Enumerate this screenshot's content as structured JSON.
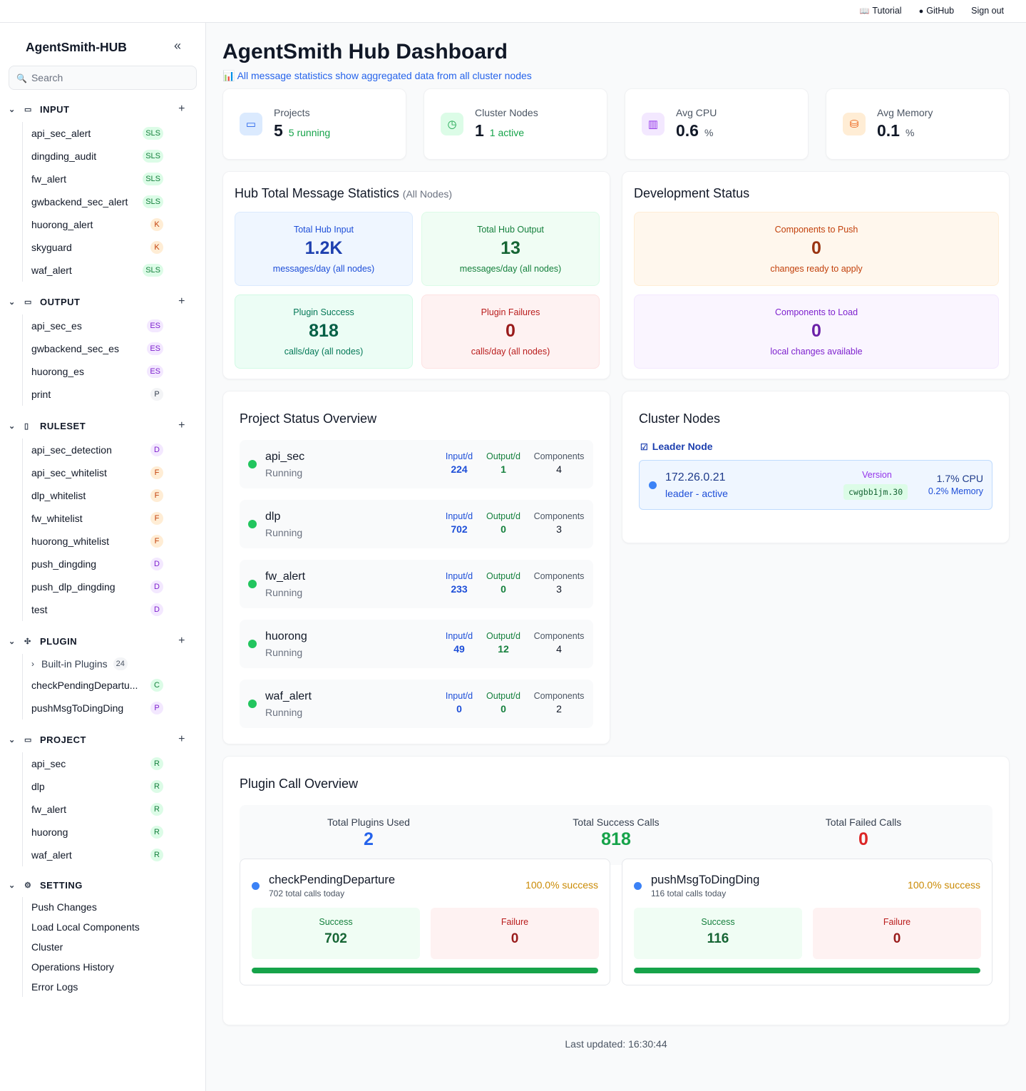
{
  "topnav": {
    "tutorial": "Tutorial",
    "github": "GitHub",
    "signout": "Sign out"
  },
  "sidebar": {
    "brand": "AgentSmith-HUB",
    "search_placeholder": "Search",
    "input": {
      "title": "INPUT",
      "items": [
        {
          "label": "api_sec_alert",
          "badge": "SLS"
        },
        {
          "label": "dingding_audit",
          "badge": "SLS"
        },
        {
          "label": "fw_alert",
          "badge": "SLS"
        },
        {
          "label": "gwbackend_sec_alert",
          "badge": "SLS"
        },
        {
          "label": "huorong_alert",
          "badge": "K"
        },
        {
          "label": "skyguard",
          "badge": "K"
        },
        {
          "label": "waf_alert",
          "badge": "SLS"
        }
      ]
    },
    "output": {
      "title": "OUTPUT",
      "items": [
        {
          "label": "api_sec_es",
          "badge": "ES"
        },
        {
          "label": "gwbackend_sec_es",
          "badge": "ES"
        },
        {
          "label": "huorong_es",
          "badge": "ES"
        },
        {
          "label": "print",
          "badge": "P"
        }
      ]
    },
    "ruleset": {
      "title": "RULESET",
      "items": [
        {
          "label": "api_sec_detection",
          "badge": "D"
        },
        {
          "label": "api_sec_whitelist",
          "badge": "F"
        },
        {
          "label": "dlp_whitelist",
          "badge": "F"
        },
        {
          "label": "fw_whitelist",
          "badge": "F"
        },
        {
          "label": "huorong_whitelist",
          "badge": "F"
        },
        {
          "label": "push_dingding",
          "badge": "D"
        },
        {
          "label": "push_dlp_dingding",
          "badge": "D"
        },
        {
          "label": "test",
          "badge": "D"
        }
      ]
    },
    "plugin": {
      "title": "PLUGIN",
      "builtin_label": "Built-in Plugins",
      "builtin_count": "24",
      "items": [
        {
          "label": "checkPendingDepartu...",
          "badge": "C"
        },
        {
          "label": "pushMsgToDingDing",
          "badge": "P"
        }
      ]
    },
    "project": {
      "title": "PROJECT",
      "items": [
        {
          "label": "api_sec",
          "badge": "R"
        },
        {
          "label": "dlp",
          "badge": "R"
        },
        {
          "label": "fw_alert",
          "badge": "R"
        },
        {
          "label": "huorong",
          "badge": "R"
        },
        {
          "label": "waf_alert",
          "badge": "R"
        }
      ]
    },
    "setting": {
      "title": "SETTING",
      "items": [
        "Push Changes",
        "Load Local Components",
        "Cluster",
        "Operations History",
        "Error Logs"
      ]
    }
  },
  "main": {
    "title": "AgentSmith Hub Dashboard",
    "subtitle": "All message statistics show aggregated data from all cluster nodes",
    "subtitle_icon": "📊",
    "stats": [
      {
        "label": "Projects",
        "value": "5",
        "note": "5 running"
      },
      {
        "label": "Cluster Nodes",
        "value": "1",
        "note": "1 active"
      },
      {
        "label": "Avg CPU",
        "value": "0.6",
        "note": "%"
      },
      {
        "label": "Avg Memory",
        "value": "0.1",
        "note": "%"
      }
    ],
    "hub_stats": {
      "title": "Hub Total Message Statistics",
      "title_note": "(All Nodes)",
      "tiles": [
        {
          "label": "Total Hub Input",
          "value": "1.2K",
          "sub": "messages/day (all nodes)"
        },
        {
          "label": "Total Hub Output",
          "value": "13",
          "sub": "messages/day (all nodes)"
        },
        {
          "label": "Plugin Success",
          "value": "818",
          "sub": "calls/day (all nodes)"
        },
        {
          "label": "Plugin Failures",
          "value": "0",
          "sub": "calls/day (all nodes)"
        }
      ]
    },
    "dev_status": {
      "title": "Development Status",
      "tiles": [
        {
          "label": "Components to Push",
          "value": "0",
          "sub": "changes ready to apply"
        },
        {
          "label": "Components to Load",
          "value": "0",
          "sub": "local changes available"
        }
      ]
    },
    "projects": {
      "title": "Project Status Overview",
      "col_in": "Input/d",
      "col_out": "Output/d",
      "col_comp": "Components",
      "rows": [
        {
          "name": "api_sec",
          "status": "Running",
          "in": "224",
          "out": "1",
          "comp": "4"
        },
        {
          "name": "dlp",
          "status": "Running",
          "in": "702",
          "out": "0",
          "comp": "3"
        },
        {
          "name": "fw_alert",
          "status": "Running",
          "in": "233",
          "out": "0",
          "comp": "3"
        },
        {
          "name": "huorong",
          "status": "Running",
          "in": "49",
          "out": "12",
          "comp": "4"
        },
        {
          "name": "waf_alert",
          "status": "Running",
          "in": "0",
          "out": "0",
          "comp": "2"
        }
      ]
    },
    "cluster": {
      "title": "Cluster Nodes",
      "leader_label": "Leader Node",
      "node": {
        "ip": "172.26.0.21",
        "role": "leader - active",
        "version_label": "Version",
        "version": "cwgbb1jm.30",
        "cpu": "1.7% CPU",
        "mem": "0.2% Memory"
      }
    },
    "plugins": {
      "title": "Plugin Call Overview",
      "summary": [
        {
          "label": "Total Plugins Used",
          "value": "2",
          "color": "#2563eb"
        },
        {
          "label": "Total Success Calls",
          "value": "818",
          "color": "#16a34a"
        },
        {
          "label": "Total Failed Calls",
          "value": "0",
          "color": "#dc2626"
        }
      ],
      "cards": [
        {
          "name": "checkPendingDeparture",
          "total": "702",
          "total_suffix": "total calls today",
          "rate": "100.0% success",
          "success_label": "Success",
          "success": "702",
          "failure_label": "Failure",
          "failure": "0",
          "success_fraction": 1.0
        },
        {
          "name": "pushMsgToDingDing",
          "total": "116",
          "total_suffix": "total calls today",
          "rate": "100.0% success",
          "success_label": "Success",
          "success": "116",
          "failure_label": "Failure",
          "failure": "0",
          "success_fraction": 1.0
        }
      ]
    },
    "last_updated": "Last updated: 16:30:44"
  }
}
